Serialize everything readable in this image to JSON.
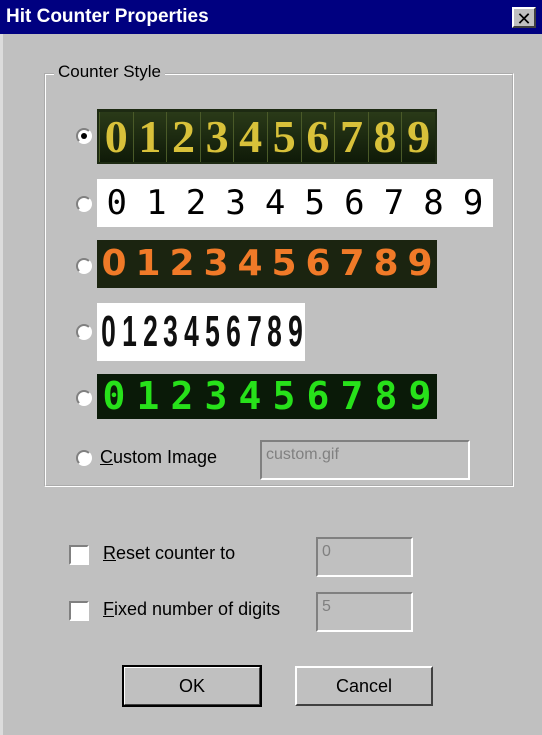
{
  "window": {
    "title": "Hit Counter Properties",
    "close_glyph": "✕"
  },
  "group": {
    "legend": "Counter Style"
  },
  "styles": [
    {
      "digits": [
        "0",
        "1",
        "2",
        "3",
        "4",
        "5",
        "6",
        "7",
        "8",
        "9"
      ],
      "checked": true
    },
    {
      "digits": [
        "0",
        "1",
        "2",
        "3",
        "4",
        "5",
        "6",
        "7",
        "8",
        "9"
      ],
      "checked": false
    },
    {
      "digits": [
        "0",
        "1",
        "2",
        "3",
        "4",
        "5",
        "6",
        "7",
        "8",
        "9"
      ],
      "checked": false
    },
    {
      "digits": [
        "0",
        "1",
        "2",
        "3",
        "4",
        "5",
        "6",
        "7",
        "8",
        "9"
      ],
      "checked": false
    },
    {
      "digits": [
        "0",
        "1",
        "2",
        "3",
        "4",
        "5",
        "6",
        "7",
        "8",
        "9"
      ],
      "checked": false
    }
  ],
  "custom": {
    "label_accel": "C",
    "label_rest": "ustom Image",
    "checked": false,
    "value": "custom.gif"
  },
  "reset": {
    "label_accel": "R",
    "label_rest": "eset counter to",
    "checked": false,
    "value": "0"
  },
  "fixed": {
    "label_accel": "F",
    "label_rest": "ixed number of digits",
    "checked": false,
    "value": "5"
  },
  "buttons": {
    "ok": "OK",
    "cancel": "Cancel"
  }
}
